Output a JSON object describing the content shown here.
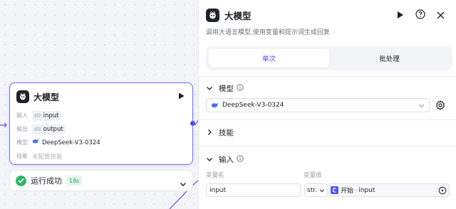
{
  "node": {
    "title": "大模型",
    "rows": {
      "input_label": "输入",
      "input_type": "str.",
      "input_value": "input",
      "output_label": "输出",
      "output_type": "str.",
      "output_value": "output",
      "model_label": "模型",
      "model_value": "DeepSeek-V3-0324",
      "skill_label": "技能",
      "skill_value": "未配置技能"
    }
  },
  "status": {
    "text": "运行成功",
    "time": "18s"
  },
  "panel": {
    "title": "大模型",
    "description": "调用大语言模型,使用变量和提示词生成回复",
    "tabs": [
      {
        "label": "单次",
        "active": true
      },
      {
        "label": "批处理",
        "active": false
      }
    ],
    "model_section": {
      "label": "模型",
      "selected_model": "DeepSeek-V3-0324"
    },
    "skill_section": {
      "label": "技能"
    },
    "input_section": {
      "label": "输入",
      "col_name": "变量名",
      "col_value": "变量值",
      "var_name": "input",
      "var_type": "str.",
      "ref_source": "开始",
      "ref_sep": "-",
      "ref_field": "input"
    }
  },
  "colors": {
    "accent": "#4f55e6",
    "node_border": "#6b6ff0",
    "success": "#2fb46a",
    "muted_text": "#9ca0aa"
  },
  "icons": [
    "robot-logo-icon",
    "play-icon",
    "help-icon",
    "close-icon",
    "chevron-down-icon",
    "chevron-right-icon",
    "info-icon",
    "gear-icon",
    "whale-icon",
    "check-icon",
    "start-node-icon",
    "target-icon"
  ]
}
